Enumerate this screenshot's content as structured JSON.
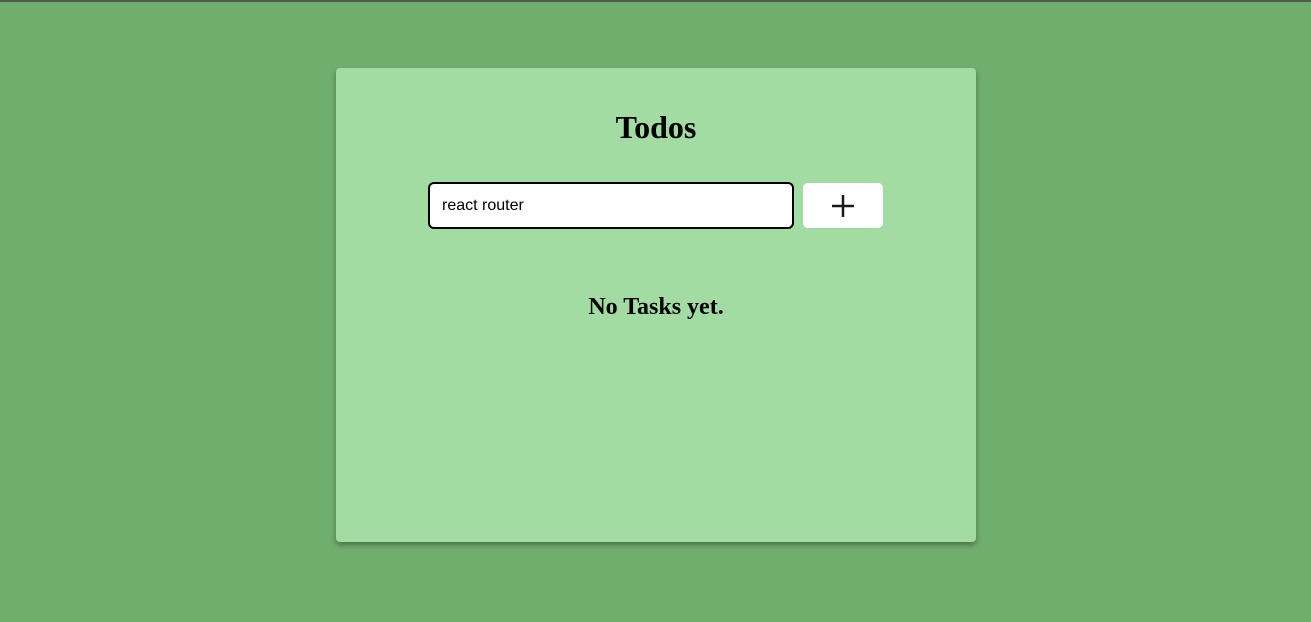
{
  "todo": {
    "title": "Todos",
    "input": {
      "value": "react router",
      "placeholder": ""
    },
    "add_button": {
      "icon": "plus-icon"
    },
    "empty_message": "No Tasks yet."
  },
  "colors": {
    "background": "#70ae6e",
    "card": "#a3dca3",
    "input_background": "#ffffff",
    "button_background": "#ffffff",
    "text": "#000000"
  }
}
